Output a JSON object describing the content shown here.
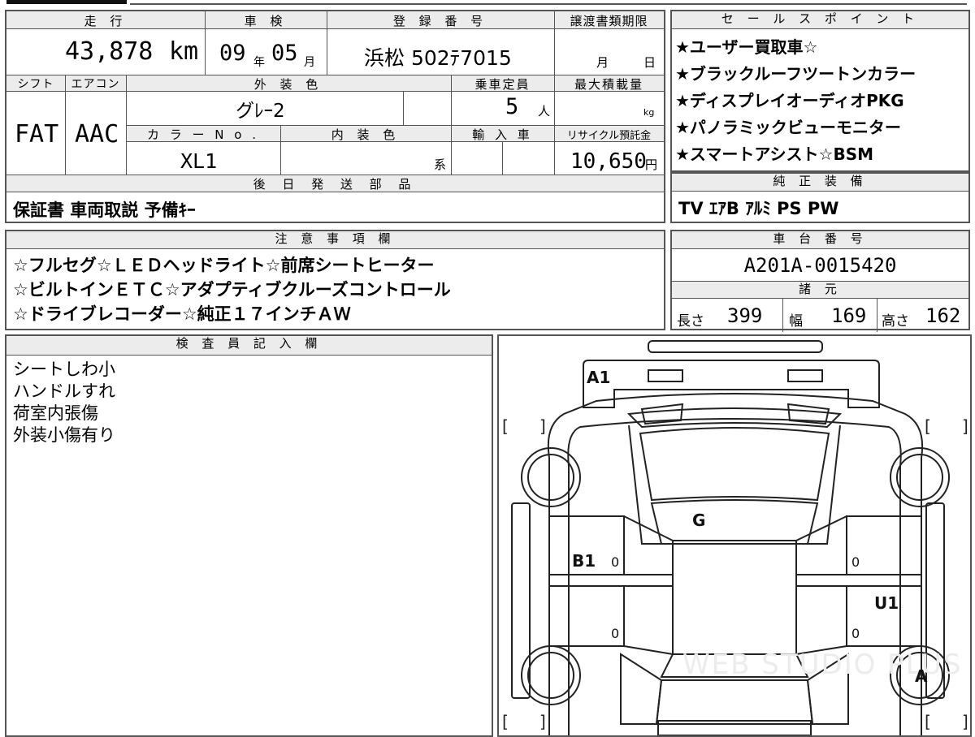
{
  "headers": {
    "mileage": "走 行",
    "inspection": "車 検",
    "registration": "登 録 番 号",
    "transfer_deadline": "譲渡書類期限",
    "shift": "シフト",
    "aircon": "エアコン",
    "exterior_color": "外 装 色",
    "capacity": "乗車定員",
    "max_load": "最大積載量",
    "color_no": "カ ラ ー N o .",
    "interior_color": "内 装 色",
    "import": "輸 入 車",
    "recycle": "リサイクル預託金",
    "later_parts": "後 日 発 送 部 品",
    "sales_points": "セ ー ル ス ポ イ ン ト",
    "genuine_equipment": "純 正 装 備",
    "notes": "注 意 事 項 欄",
    "chassis_no": "車 台 番 号",
    "specs": "諸 元",
    "inspector": "検 査 員 記 入 欄"
  },
  "vehicle": {
    "mileage": "43,878",
    "mileage_unit": "km",
    "inspection_year": "09",
    "inspection_year_unit": "年",
    "inspection_month": "05",
    "inspection_month_unit": "月",
    "registration": "浜松 502ﾃ7015",
    "deadline_month_unit": "月",
    "deadline_day_unit": "日",
    "shift": "FAT",
    "aircon": "AAC",
    "exterior_color": "グﾚｰ2",
    "capacity": "5",
    "capacity_unit": "人",
    "load_unit": "kg",
    "color_no": "XL1",
    "interior_suffix": "系",
    "recycle_amount": "10,650",
    "recycle_unit": "円",
    "later_parts": "保証書 車両取説 予備ｷｰ",
    "chassis_no": "A201A-0015420",
    "length_label": "長さ",
    "length": "399",
    "width_label": "幅",
    "width": "169",
    "height_label": "高さ",
    "height": "162"
  },
  "sales_points": [
    "★ユーザー買取車☆",
    "★ブラックルーフツートンカラー",
    "★ディスプレイオーディオPKG",
    "★パノラミックビューモニター",
    "★スマートアシスト☆BSM"
  ],
  "genuine_equipment": "TV ｴｱB ｱﾙﾐ PS PW",
  "notes": [
    "☆フルセグ☆ＬＥＤヘッドライト☆前席シートヒーター",
    "☆ビルトインＥＴＣ☆アダプティブクルーズコントロール",
    "☆ドライブレコーダー☆純正１７インチＡＷ"
  ],
  "inspector_notes": [
    "シートしわ小",
    "ハンドルすれ",
    "荷室内張傷",
    "外装小傷有り"
  ],
  "damage_marks": {
    "front": "A1",
    "top": "G",
    "left_door": "B1",
    "right_rear": "U1",
    "right_rear_wheel": "A",
    "zero": "0",
    "bracket_open": "[",
    "bracket_close": "]"
  },
  "watermark": "WEB STUDIO PLUS"
}
